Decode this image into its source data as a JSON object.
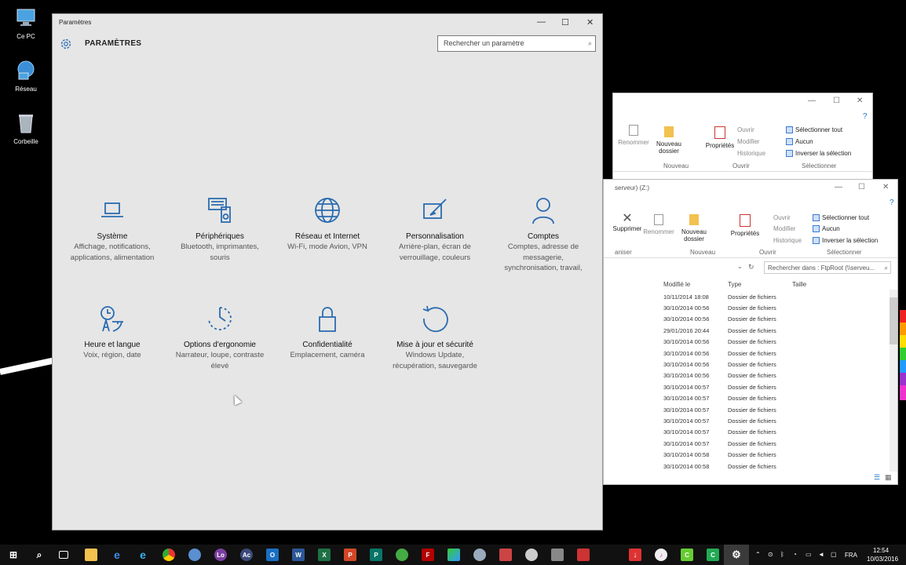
{
  "desktop": {
    "icons": [
      {
        "label": "Ce PC"
      },
      {
        "label": "Réseau"
      },
      {
        "label": "Corbeille"
      }
    ]
  },
  "explorer_back": {
    "ribbon": {
      "rename": "Renommer",
      "new_folder": "Nouveau dossier",
      "properties": "Propriétés",
      "open": "Ouvrir",
      "edit": "Modifier",
      "history": "Historique",
      "select_all": "Sélectionner tout",
      "select_none": "Aucun",
      "invert": "Inverser la sélection",
      "group_new": "Nouveau",
      "group_open": "Ouvrir",
      "group_select": "Sélectionner"
    }
  },
  "explorer_front": {
    "address": "serveur) (Z:)",
    "search_placeholder": "Rechercher dans : FtpRoot (\\\\serveu...",
    "ribbon": {
      "delete": "Supprimer",
      "rename": "Renommer",
      "new_folder": "Nouveau dossier",
      "properties": "Propriétés",
      "open": "Ouvrir",
      "edit": "Modifier",
      "history": "Historique",
      "select_all": "Sélectionner tout",
      "select_none": "Aucun",
      "invert": "Inverser la sélection",
      "group_organize": "aniser",
      "group_new": "Nouveau",
      "group_open": "Ouvrir",
      "group_select": "Sélectionner"
    },
    "columns": [
      "Modifié le",
      "Type",
      "Taille"
    ],
    "rows": [
      [
        "10/11/2014 18:08",
        "Dossier de fichiers"
      ],
      [
        "30/10/2014 00:56",
        "Dossier de fichiers"
      ],
      [
        "30/10/2014 00:56",
        "Dossier de fichiers"
      ],
      [
        "29/01/2016 20:44",
        "Dossier de fichiers"
      ],
      [
        "30/10/2014 00:56",
        "Dossier de fichiers"
      ],
      [
        "30/10/2014 00:56",
        "Dossier de fichiers"
      ],
      [
        "30/10/2014 00:56",
        "Dossier de fichiers"
      ],
      [
        "30/10/2014 00:56",
        "Dossier de fichiers"
      ],
      [
        "30/10/2014 00:57",
        "Dossier de fichiers"
      ],
      [
        "30/10/2014 00:57",
        "Dossier de fichiers"
      ],
      [
        "30/10/2014 00:57",
        "Dossier de fichiers"
      ],
      [
        "30/10/2014 00:57",
        "Dossier de fichiers"
      ],
      [
        "30/10/2014 00:57",
        "Dossier de fichiers"
      ],
      [
        "30/10/2014 00:57",
        "Dossier de fichiers"
      ],
      [
        "30/10/2014 00:58",
        "Dossier de fichiers"
      ],
      [
        "30/10/2014 00:58",
        "Dossier de fichiers"
      ]
    ]
  },
  "settings": {
    "window_title": "Paramètres",
    "heading": "PARAMÈTRES",
    "search_placeholder": "Rechercher un paramètre",
    "accent": "#2b6cb0",
    "tiles": [
      {
        "icon": "laptop-icon",
        "name": "Système",
        "desc": "Affichage, notifications, applications, alimentation"
      },
      {
        "icon": "keyboard-speaker-icon",
        "name": "Périphériques",
        "desc": "Bluetooth, imprimantes, souris"
      },
      {
        "icon": "globe-icon",
        "name": "Réseau et Internet",
        "desc": "Wi-Fi, mode Avion, VPN"
      },
      {
        "icon": "paint-icon",
        "name": "Personnalisation",
        "desc": "Arrière-plan, écran de verrouillage, couleurs"
      },
      {
        "icon": "person-icon",
        "name": "Comptes",
        "desc": "Comptes, adresse de messagerie, synchronisation, travail,"
      },
      {
        "icon": "clock-language-icon",
        "name": "Heure et langue",
        "desc": "Voix, région, date"
      },
      {
        "icon": "ease-of-access-icon",
        "name": "Options d'ergonomie",
        "desc": "Narrateur, loupe, contraste élevé"
      },
      {
        "icon": "lock-icon",
        "name": "Confidentialité",
        "desc": "Emplacement, caméra"
      },
      {
        "icon": "update-icon",
        "name": "Mise à jour et sécurité",
        "desc": "Windows Update, récupération, sauvegarde"
      }
    ]
  },
  "taskbar": {
    "language": "FRA",
    "time": "12:54",
    "date": "10/03/2016",
    "app_labels": {
      "lo": "Lo",
      "ac": "Ac"
    }
  }
}
